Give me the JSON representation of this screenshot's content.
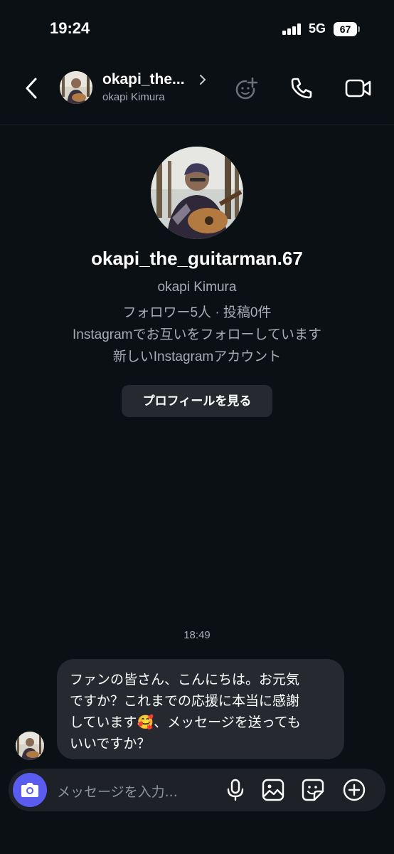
{
  "status_bar": {
    "time": "19:24",
    "network": "5G",
    "battery": "67"
  },
  "header": {
    "username": "okapi_the...",
    "display_name": "okapi Kimura",
    "icons": [
      "back-icon",
      "chevron-right-icon",
      "add-people-icon",
      "phone-icon",
      "video-camera-icon"
    ]
  },
  "profile": {
    "username": "okapi_the_guitarman.67",
    "display_name": "okapi Kimura",
    "stats": "フォロワー5人 · 投稿0件",
    "mutual": "Instagramでお互いをフォローしています",
    "account_note": "新しいInstagramアカウント",
    "view_profile_label": "プロフィールを見る"
  },
  "chat": {
    "timestamp": "18:49",
    "message": {
      "line1": "ファンの皆さん、こんにちは。お元気",
      "line2": "ですか？これまでの応援に本当に感謝",
      "line3a": "しています",
      "emoji": "🥰",
      "line3b": "、メッセージを送っても",
      "line4": "いいですか？"
    }
  },
  "composer": {
    "placeholder": "メッセージを入力...",
    "icons": [
      "camera-icon",
      "microphone-icon",
      "gallery-icon",
      "sticker-icon",
      "plus-icon"
    ]
  },
  "colors": {
    "background": "#0b1014",
    "bubble": "#262a30",
    "accent": "#5a5cf0",
    "secondary_text": "#a8adb3"
  }
}
